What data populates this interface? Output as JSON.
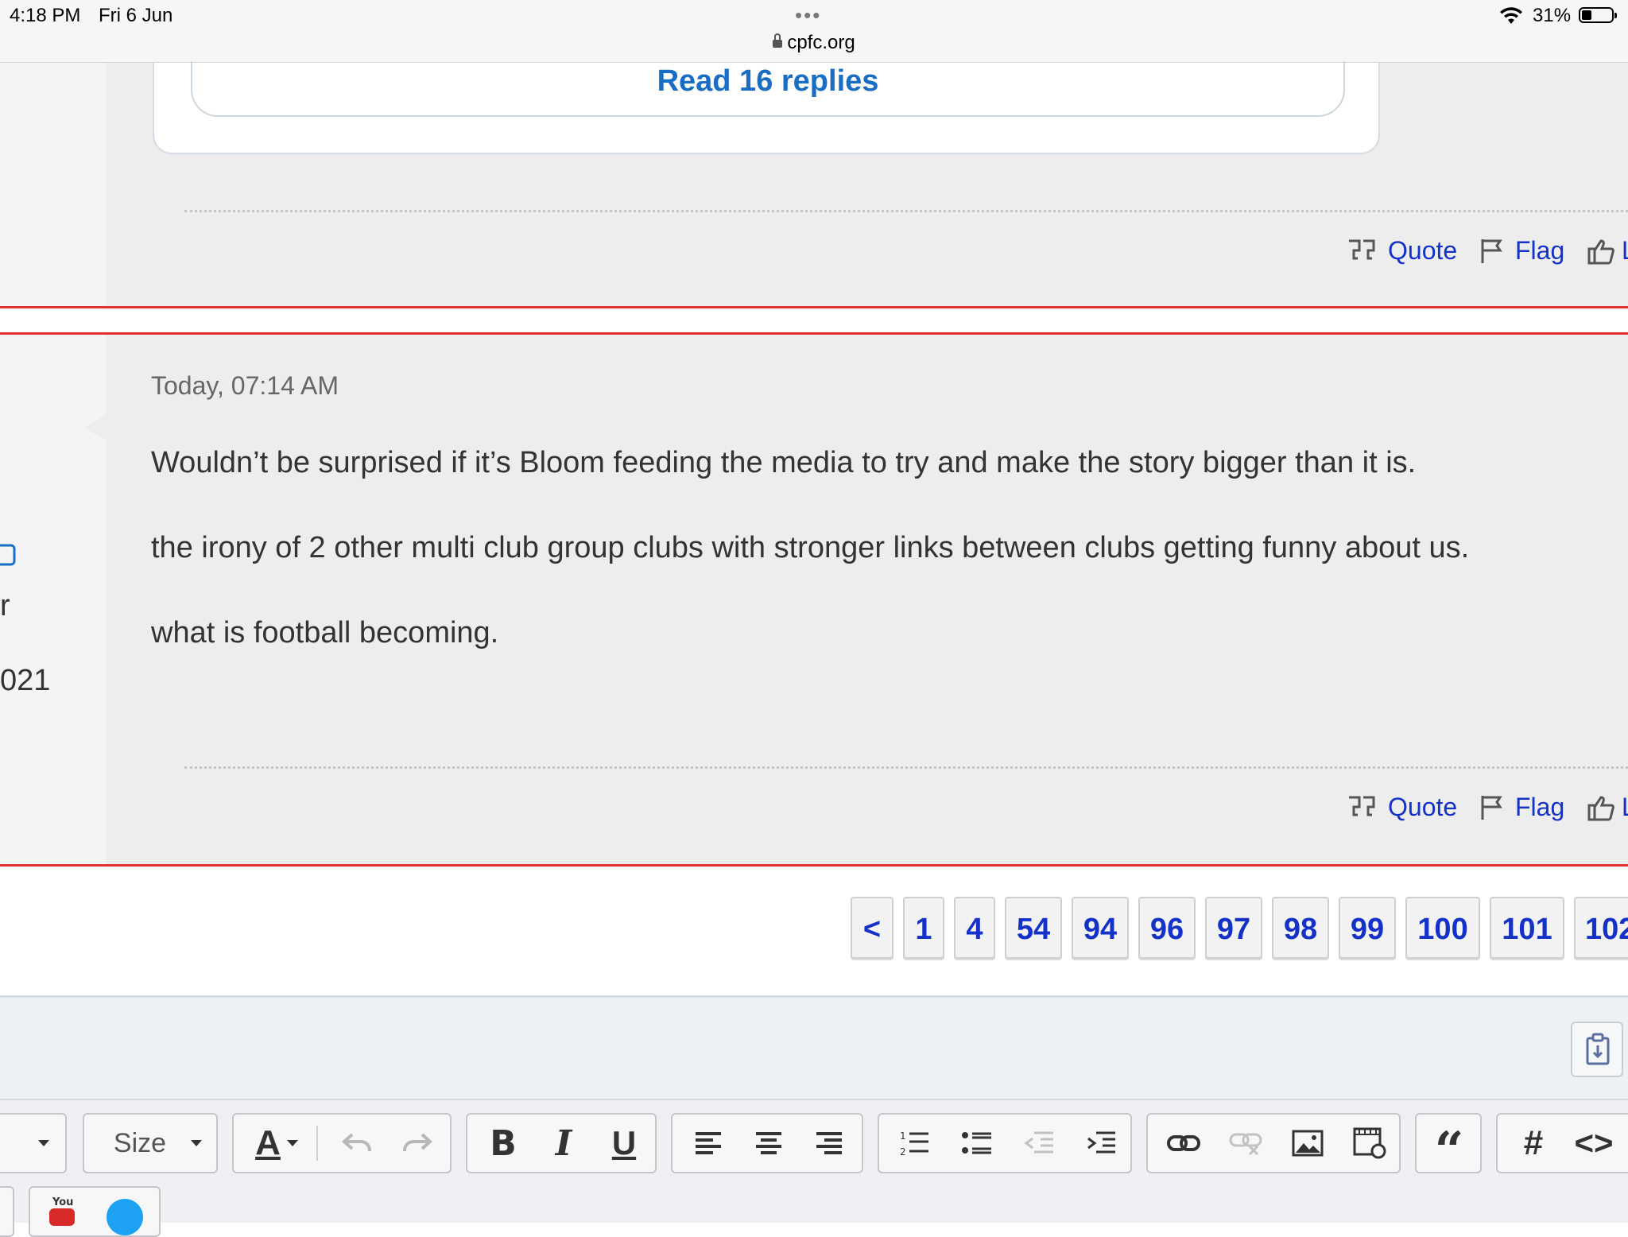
{
  "status_bar": {
    "time": "4:18 PM",
    "date": "Fri 6 Jun",
    "url": "cpfc.org",
    "battery": "31%",
    "dots": "•••"
  },
  "post1": {
    "read_replies": "Read 16 replies"
  },
  "actions": {
    "quote": "Quote",
    "flag": "Flag",
    "like_fragment": "L"
  },
  "post2": {
    "timestamp": "Today, 07:14 AM",
    "paragraphs": [
      "Wouldn’t be surprised if it’s Bloom feeding the media to try and make the story bigger than it is.",
      "the irony of 2 other multi club group clubs with stronger links between clubs getting funny about us.",
      "what is football becoming."
    ],
    "sidebar_fragments": {
      "r": "r",
      "year": "021"
    }
  },
  "pagination": {
    "prev": "<",
    "pages": [
      "1",
      "4",
      "54",
      "94",
      "96",
      "97",
      "98",
      "99",
      "100",
      "101",
      "102"
    ]
  },
  "editor": {
    "size_label": "Size",
    "font_color_label": "A",
    "bold": "B",
    "italic": "I",
    "underline": "U",
    "quote": "66",
    "hash": "#",
    "code": "<>"
  },
  "colors": {
    "link": "#1432c8",
    "replies_link": "#1a6dc4",
    "separator_red": "#e03030",
    "twitter": "#1da1f2",
    "youtube": "#d92a2a"
  }
}
